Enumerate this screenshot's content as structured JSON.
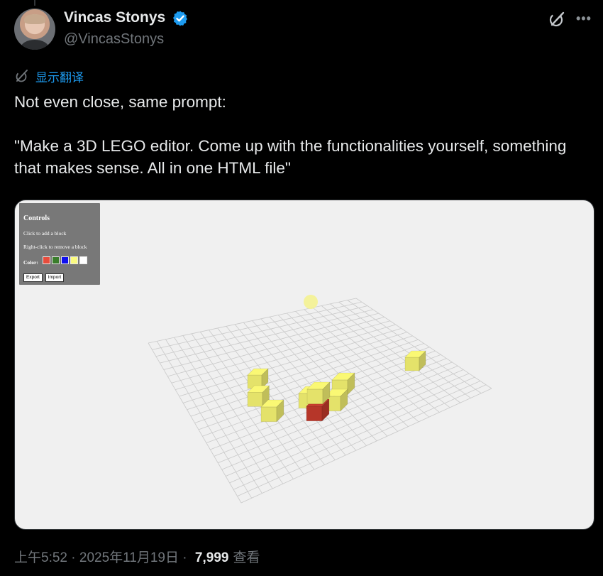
{
  "author": {
    "name": "Vincas Stonys",
    "handle": "@VincasStonys"
  },
  "icons": {
    "verified": "verified-badge-icon",
    "grok": "grok-icon",
    "more": "more-icon",
    "translate": "translate-icon"
  },
  "translate_label": "显示翻译",
  "tweet_text": "Not even close, same prompt:\n\n\"Make a 3D LEGO editor. Come up with the functionalities yourself, something that makes sense. All in one HTML file\"",
  "media": {
    "controls": {
      "title": "Controls",
      "line1": "Click to add a block",
      "line2": "Right-click to remove a block",
      "color_label": "Color:",
      "swatches": [
        "#e74c3c",
        "#3a7d2c",
        "#1010ee",
        "#fbfb80",
        "#ffffff"
      ],
      "export_label": "Export",
      "import_label": "Import"
    },
    "block_color": "#f0ee70",
    "red_block_color": "#c0392b"
  },
  "footer": {
    "time": "上午5:52",
    "sep1": " · ",
    "date": "2025年11月19日",
    "sep2": " · ",
    "views": "7,999",
    "views_label": "查看"
  },
  "colors": {
    "accent": "#1d9bf0",
    "text": "#e7e9ea",
    "muted": "#71767b",
    "background": "#000000"
  }
}
